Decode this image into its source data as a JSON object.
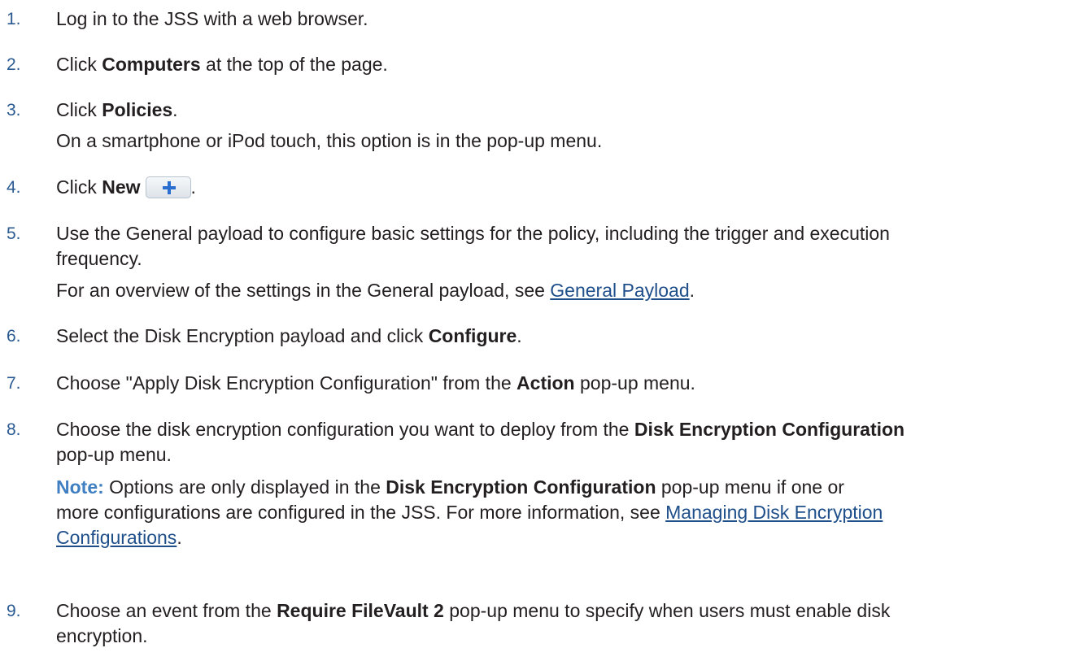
{
  "steps": [
    {
      "num": "1.",
      "parts": [
        "Log in to the JSS with a web browser."
      ]
    },
    {
      "num": "2.",
      "pre": "Click ",
      "bold": "Computers",
      "post": " at the top of the page."
    },
    {
      "num": "3.",
      "pre": "Click ",
      "bold": "Policies",
      "post": ".",
      "sub": "On a smartphone or iPod touch, this option is in the pop-up menu."
    },
    {
      "num": "4.",
      "pre": "Click ",
      "bold": "New",
      "post": "."
    },
    {
      "num": "5.",
      "line1": "Use the General payload to configure basic settings for the policy, including the trigger and execution",
      "line2": "frequency.",
      "sub_pre": "For an overview of the settings in the General payload, see ",
      "sub_link": "General Payload",
      "sub_post": "."
    },
    {
      "num": "6.",
      "pre": "Select the Disk Encryption payload and click ",
      "bold": "Configure",
      "post": "."
    },
    {
      "num": "7.",
      "pre": "Choose \"Apply Disk Encryption Configuration\" from the ",
      "bold": "Action",
      "post": " pop-up menu."
    },
    {
      "num": "8.",
      "pre": "Choose the disk encryption configuration you want to deploy from the ",
      "bold": "Disk Encryption Configuration",
      "line2": "pop-up menu.",
      "note_label": "Note:",
      "note_pre": " Options are only displayed in the ",
      "note_bold": "Disk Encryption Configuration",
      "note_post": " pop-up menu if one or",
      "note_line2_pre": "more configurations are configured in the JSS. For more information, see ",
      "note_link1": "Managing Disk Encryption ",
      "note_link2": "Configurations",
      "note_post2": "."
    },
    {
      "num": "9.",
      "pre": "Choose an event from the ",
      "bold": "Require FileVault 2",
      "post": " pop-up menu to specify when users must enable disk",
      "line2": "encryption."
    }
  ],
  "icons": {
    "new_button": "plus-icon"
  },
  "colors": {
    "step_number": "#2a5a91",
    "link": "#1e4f8a",
    "note_label": "#3f7fc2",
    "plus": "#2a6fd0"
  }
}
